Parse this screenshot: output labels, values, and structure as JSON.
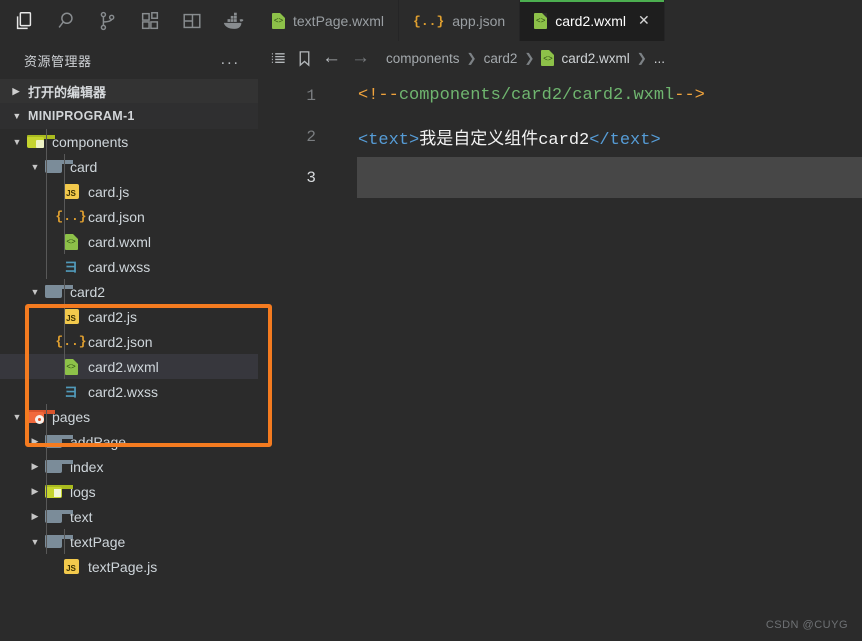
{
  "activity_bar": {
    "items": [
      {
        "name": "explorer-icon",
        "label": "资源管理器",
        "active": true
      },
      {
        "name": "search-icon",
        "label": "搜索",
        "active": false
      },
      {
        "name": "source-control-icon",
        "label": "源代码管理",
        "active": false
      },
      {
        "name": "extensions-icon",
        "label": "扩展",
        "active": false
      },
      {
        "name": "layout-icon",
        "label": "布局",
        "active": false
      },
      {
        "name": "docker-icon",
        "label": "Docker",
        "active": false
      }
    ]
  },
  "explorer": {
    "title": "资源管理器",
    "more_actions": "...",
    "open_editors_label": "打开的编辑器",
    "project_name": "MINIPROGRAM-1",
    "tree": [
      {
        "label": "components",
        "icon": "folder-green",
        "indent": 1,
        "twisty": "▼",
        "selected": false
      },
      {
        "label": "card",
        "icon": "folder-gray",
        "indent": 2,
        "twisty": "▼",
        "selected": false
      },
      {
        "label": "card.js",
        "icon": "js",
        "indent": 3,
        "twisty": "",
        "selected": false
      },
      {
        "label": "card.json",
        "icon": "json",
        "indent": 3,
        "twisty": "",
        "selected": false
      },
      {
        "label": "card.wxml",
        "icon": "wxml",
        "indent": 3,
        "twisty": "",
        "selected": false
      },
      {
        "label": "card.wxss",
        "icon": "wxss",
        "indent": 3,
        "twisty": "",
        "selected": false
      },
      {
        "label": "card2",
        "icon": "folder-gray",
        "indent": 2,
        "twisty": "▼",
        "selected": false
      },
      {
        "label": "card2.js",
        "icon": "js",
        "indent": 3,
        "twisty": "",
        "selected": false
      },
      {
        "label": "card2.json",
        "icon": "json",
        "indent": 3,
        "twisty": "",
        "selected": false
      },
      {
        "label": "card2.wxml",
        "icon": "wxml",
        "indent": 3,
        "twisty": "",
        "selected": true
      },
      {
        "label": "card2.wxss",
        "icon": "wxss",
        "indent": 3,
        "twisty": "",
        "selected": false
      },
      {
        "label": "pages",
        "icon": "folder-orange",
        "indent": 1,
        "twisty": "▼",
        "selected": false
      },
      {
        "label": "addPage",
        "icon": "folder-gray",
        "indent": 2,
        "twisty": "▶",
        "selected": false
      },
      {
        "label": "index",
        "icon": "folder-gray",
        "indent": 2,
        "twisty": "▶",
        "selected": false
      },
      {
        "label": "logs",
        "icon": "folder-olive",
        "indent": 2,
        "twisty": "▶",
        "selected": false
      },
      {
        "label": "text",
        "icon": "folder-gray",
        "indent": 2,
        "twisty": "▶",
        "selected": false
      },
      {
        "label": "textPage",
        "icon": "folder-gray",
        "indent": 2,
        "twisty": "▼",
        "selected": false
      },
      {
        "label": "textPage.js",
        "icon": "js",
        "indent": 3,
        "twisty": "",
        "selected": false
      }
    ]
  },
  "tabs": [
    {
      "label": "textPage.wxml",
      "icon": "wxml",
      "active": false,
      "closable": false
    },
    {
      "label": "app.json",
      "icon": "json",
      "active": false,
      "closable": false
    },
    {
      "label": "card2.wxml",
      "icon": "wxml",
      "active": true,
      "closable": true,
      "close_label": "✕"
    }
  ],
  "breadcrumb": {
    "toggle_outline_icon": "list-icon",
    "bookmark_icon": "bookmark-icon",
    "back_icon": "←",
    "forward_icon": "→",
    "crumbs": [
      "components",
      "card2",
      "card2.wxml",
      "..."
    ],
    "separator": "❯"
  },
  "editor": {
    "active_line": 3,
    "lines": [
      {
        "number": "1",
        "active": false,
        "tokens": [
          {
            "t": "<!--",
            "c": "punct"
          },
          {
            "t": "components/card2/card2.wxml",
            "c": "comment"
          },
          {
            "t": "-->",
            "c": "punct"
          }
        ]
      },
      {
        "number": "2",
        "active": false,
        "tokens": [
          {
            "t": "<text>",
            "c": "tag"
          },
          {
            "t": "我是自定义组件card2",
            "c": "plain"
          },
          {
            "t": "</text>",
            "c": "tag"
          }
        ]
      },
      {
        "number": "3",
        "active": true,
        "tokens": []
      }
    ]
  },
  "annotation": {
    "color": "#f47b20",
    "highlights": [
      "card2",
      "card2.js",
      "card2.json",
      "card2.wxml",
      "card2.wxss"
    ]
  },
  "watermark": "CSDN @CUYG"
}
